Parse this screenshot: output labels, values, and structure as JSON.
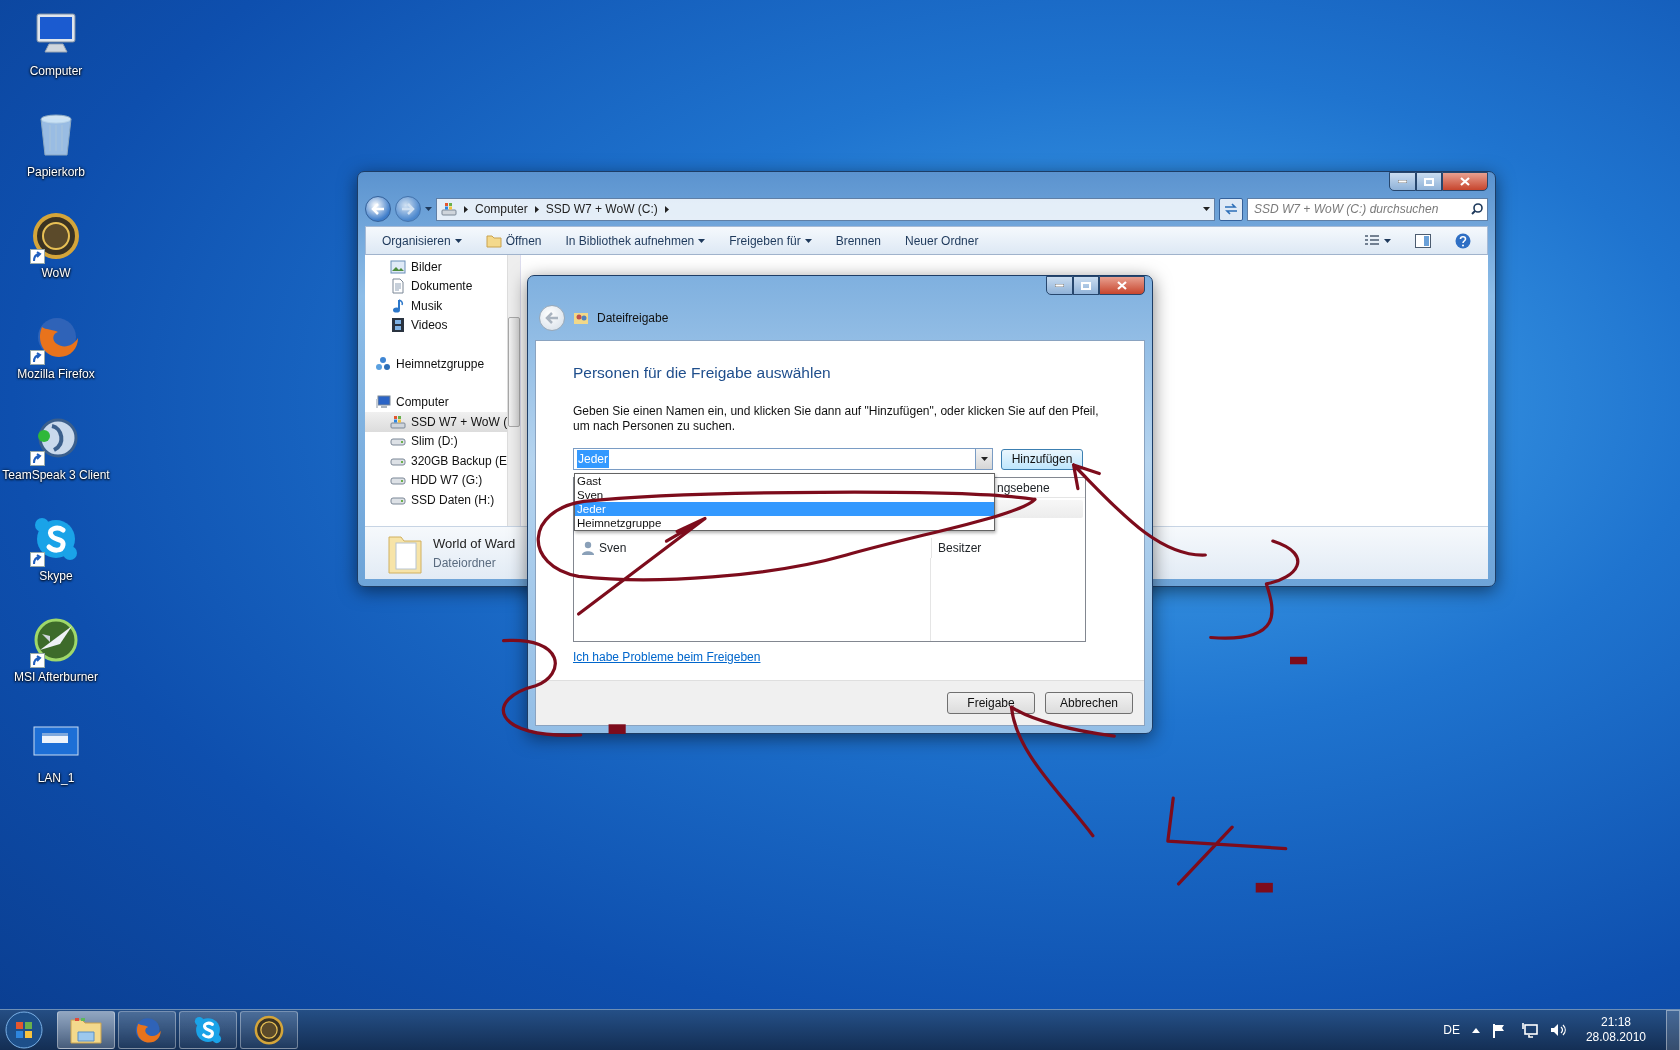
{
  "desktop_icons": [
    {
      "label": "Computer",
      "kind": "computer",
      "shortcut": false
    },
    {
      "label": "Papierkorb",
      "kind": "recycle",
      "shortcut": false
    },
    {
      "label": "WoW",
      "kind": "emblem",
      "shortcut": true
    },
    {
      "label": "Mozilla Firefox",
      "kind": "globe",
      "shortcut": true
    },
    {
      "label": "TeamSpeak 3 Client",
      "kind": "headset",
      "shortcut": true
    },
    {
      "label": "Skype",
      "kind": "bubble",
      "shortcut": true
    },
    {
      "label": "MSI Afterburner",
      "kind": "jet",
      "shortcut": true
    },
    {
      "label": "LAN_1",
      "kind": "screen",
      "shortcut": false
    }
  ],
  "explorer": {
    "breadcrumb": [
      "Computer",
      "SSD W7 + WoW (C:)"
    ],
    "search": {
      "placeholder": "SSD W7 + WoW (C:) durchsuchen"
    },
    "toolbar": [
      {
        "label": "Organisieren",
        "kind": "menu"
      },
      {
        "label": "Öffnen",
        "kind": "open"
      },
      {
        "label": "In Bibliothek aufnehmen",
        "kind": "menu"
      },
      {
        "label": "Freigeben für",
        "kind": "menu"
      },
      {
        "label": "Brennen",
        "kind": "plain"
      },
      {
        "label": "Neuer Ordner",
        "kind": "plain"
      }
    ],
    "nav": {
      "library_items": [
        {
          "label": "Bilder",
          "kind": "pictures",
          "selected": false
        },
        {
          "label": "Dokumente",
          "kind": "documents",
          "selected": false
        },
        {
          "label": "Musik",
          "kind": "music",
          "selected": false
        },
        {
          "label": "Videos",
          "kind": "videos",
          "selected": false
        }
      ],
      "items": [
        {
          "label": "Heimnetzgruppe",
          "kind": "homegroup",
          "selected": false
        },
        {
          "label": "Computer",
          "kind": "computer",
          "selected": false,
          "children": [
            {
              "label": "SSD W7 + WoW (",
              "kind": "system-drive",
              "selected": true
            },
            {
              "label": "Slim (D:)",
              "kind": "drive",
              "selected": false
            },
            {
              "label": "320GB Backup (E",
              "kind": "drive",
              "selected": false
            },
            {
              "label": "HDD W7 (G:)",
              "kind": "drive",
              "selected": false
            },
            {
              "label": "SSD Daten (H:)",
              "kind": "drive",
              "selected": false
            }
          ]
        }
      ]
    },
    "details": {
      "name": "World of Ward",
      "type": "Dateiordner"
    }
  },
  "dialog": {
    "title": "Dateifreigabe",
    "heading": "Personen für die Freigabe auswählen",
    "instructions": "Geben Sie einen Namen ein, und klicken Sie dann auf \"Hinzufügen\", oder klicken Sie auf den Pfeil, um nach Personen zu suchen.",
    "combo": {
      "value": "Jeder"
    },
    "add_button": "Hinzufügen",
    "dropdown": [
      {
        "label": "Gast",
        "selected": false
      },
      {
        "label": "Sven",
        "selected": false
      },
      {
        "label": "Jeder",
        "selected": true
      },
      {
        "label": "Heimnetzgruppe",
        "selected": false
      }
    ],
    "people_list": {
      "column_2_header": "ngsebene",
      "rows": [
        {
          "name": "Sven",
          "column_2": "Besitzer"
        }
      ]
    },
    "help_link": "Ich habe Probleme beim Freigeben",
    "buttons": [
      "Freigabe",
      "Abbrechen"
    ]
  },
  "taskbar": {
    "apps": [
      {
        "kind": "explorer",
        "active": true
      },
      {
        "kind": "globe",
        "active": false
      },
      {
        "kind": "bubble",
        "active": false
      },
      {
        "kind": "emblem",
        "active": false
      }
    ],
    "tray": {
      "language": "DE",
      "time": "21:18",
      "date": "28.08.2010"
    }
  }
}
